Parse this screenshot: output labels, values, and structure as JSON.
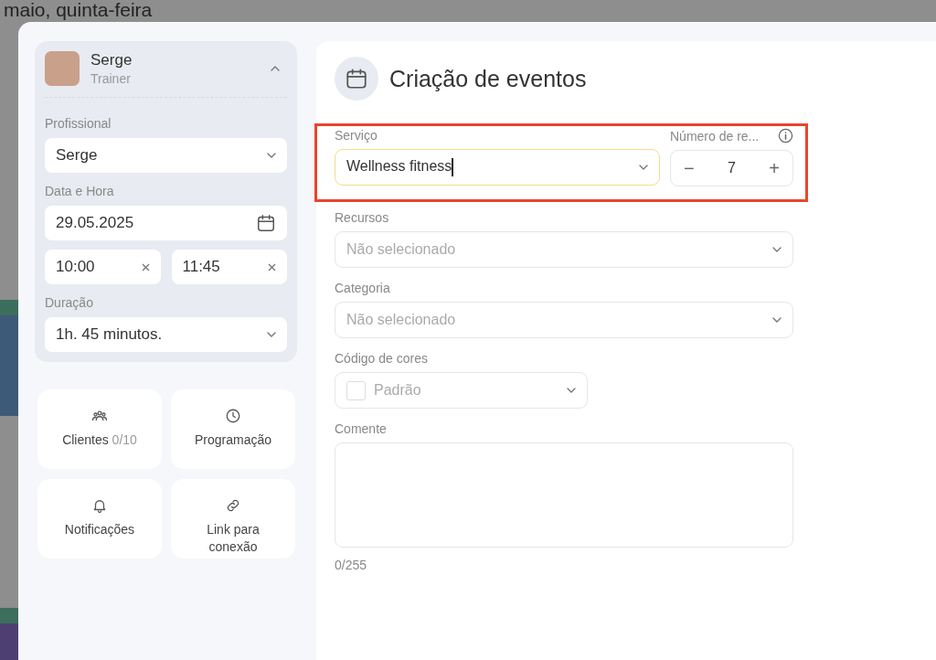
{
  "backdrop": {
    "heading": "maio, quinta-feira",
    "events": [
      {
        "color": "#3c6e5c"
      },
      {
        "color": "#3d5a78"
      },
      {
        "color": "#3c6e5c"
      },
      {
        "color": "#4e3f72"
      }
    ]
  },
  "profile": {
    "name": "Serge",
    "role": "Trainer",
    "expanded": true
  },
  "sidebar_fields": [
    {
      "label": "Profissional",
      "kind": "select",
      "value": "Serge"
    },
    {
      "label": "Data e Hora",
      "kind": "date",
      "value": "29.05.2025"
    },
    {
      "kind": "times",
      "values": [
        "10:00",
        "11:45"
      ]
    },
    {
      "label": "Duração",
      "kind": "select",
      "value": "1h. 45 minutos."
    }
  ],
  "tiles": [
    {
      "label": "Clientes",
      "count": "0/10"
    },
    {
      "label": "Programação"
    },
    {
      "label": "Notificações"
    },
    {
      "label": "Link para conexão"
    }
  ],
  "title": "Criação de eventos",
  "service": {
    "label": "Serviço",
    "value": "Wellness fitness",
    "focused": true,
    "highlighted": true
  },
  "counter": {
    "label": "Número de re...",
    "value": "7",
    "minus": "−",
    "plus": "+"
  },
  "form_fields": [
    {
      "label": "Recursos",
      "kind": "select",
      "placeholder": "Não selecionado"
    },
    {
      "label": "Categoria",
      "kind": "select",
      "placeholder": "Não selecionado"
    },
    {
      "label": "Código de cores",
      "kind": "color",
      "placeholder": "Padrão"
    },
    {
      "label": "Comente",
      "kind": "textarea",
      "counter": "0/255"
    }
  ]
}
